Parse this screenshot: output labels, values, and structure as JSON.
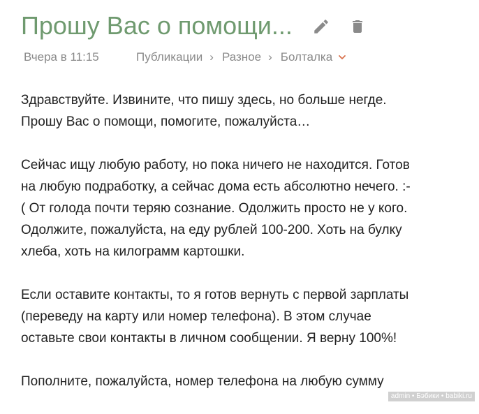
{
  "post": {
    "title": "Прошу Вас о помощи...",
    "time": "Вчера в 11:15",
    "breadcrumb": [
      {
        "label": "Публикации"
      },
      {
        "label": "Разное"
      },
      {
        "label": "Болталка"
      }
    ],
    "separator": "›",
    "paragraphs": [
      {
        "lines": [
          "Здравствуйте. Извините, что пишу здесь, но больше негде.",
          "Прошу Вас о помощи, помогите, пожалуйста…"
        ]
      },
      {
        "lines": [
          "Сейчас ищу любую работу, но пока ничего не находится. Готов",
          "на любую подработку, а сейчас дома есть абсолютно нечего. :-",
          "( От голода почти теряю сознание. Одолжить просто не у кого.",
          "Одолжите, пожалуйста, на еду рублей 100-200. Хоть на булку",
          "хлеба, хоть на килограмм картошки."
        ]
      },
      {
        "lines": [
          "Если оставите контакты, то я готов вернуть с первой зарплаты",
          "(переведу на карту или номер телефона). В этом случае",
          "оставьте свои контакты в личном сообщении. Я верну 100%!"
        ]
      },
      {
        "lines": [
          "Пополните, пожалуйста, номер телефона на любую сумму"
        ]
      }
    ]
  },
  "icons": {
    "edit": "pencil-icon",
    "delete": "trash-icon",
    "dropdown": "chevron-down-icon"
  },
  "colors": {
    "title": "#6f9a6f",
    "icon": "#8a8a8a",
    "meta": "#8a8a8a",
    "accent": "#d9734e",
    "text": "#222222"
  },
  "watermark": "admin • Бэбики • babiki.ru"
}
